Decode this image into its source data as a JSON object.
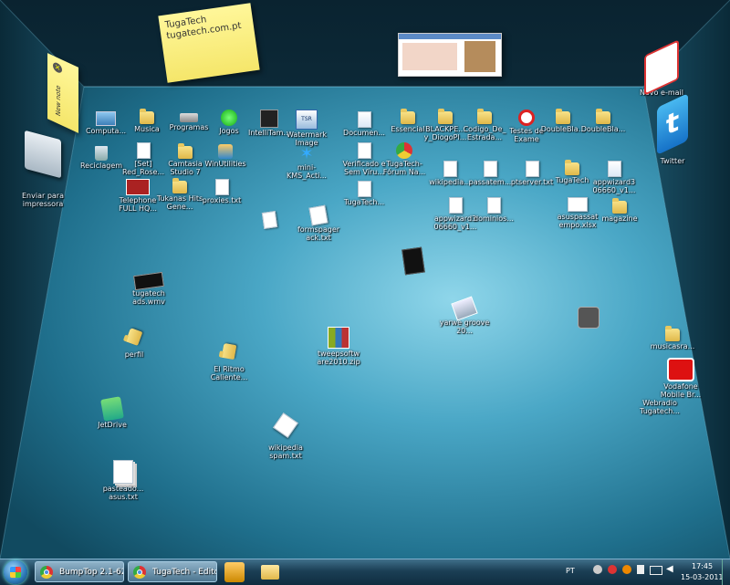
{
  "notes": {
    "note1": "TugaTech\ntugatech.com.pt",
    "note2": "New note"
  },
  "walls": {
    "left": [
      {
        "name": "printer",
        "label": "Enviar para impressora"
      }
    ],
    "right": [
      {
        "name": "new-email",
        "label": "Novo e-mail"
      },
      {
        "name": "twitter",
        "label": "Twitter"
      }
    ]
  },
  "desktop": {
    "row1": [
      "Computa...",
      "Musica",
      "Programas",
      "Jogos",
      "IntelliTam...",
      "Watermark Image",
      "Documen...",
      "Essencial",
      "BLACKPE... y_DiogoPl...",
      "Codigo_De_ Estrada...",
      "Testes de Exame",
      "DoubleBla...",
      "DoubleBla..."
    ],
    "row2": [
      "Reciclagem",
      "[Set] Red_Rose...",
      "Camtasia Studio 7",
      "WinUtilities",
      "mini-KMS_Acti...",
      "Verificado e Sem Víru...",
      "TugaTech-Fórum Na..."
    ],
    "row3": [
      "wikipedia...",
      "passatem...",
      "ptserver.txt",
      "TugaTech",
      "appwizard3 06660_v1..."
    ],
    "misc": {
      "telephone": "Telephone FULL HQ...",
      "tukanas": "Tukanas Hits Gene...",
      "proxies": "proxies.txt",
      "tugatech_doc": "TugaTech...",
      "appwiz2": "appwizard3 06660_v1...",
      "dominios": "dominios...",
      "asuspassat": "asuspassat empo.xlsx",
      "magazine": "magazine",
      "formspager": "formspager ack.txt",
      "tugatech_ads": "tugatech ads.wmv",
      "perfil": "perfil",
      "elritmo": "El Ritmo Caliente...",
      "tweepsoft": "tweepsoftw are2010.zip",
      "yarwe": "yarwe groove 20...",
      "musicasra": "musicasra...",
      "vodafone": "Vodafone Mobile Br...",
      "webradio": "Webradio Tugatech...",
      "jetdrive": "JetDrive",
      "wikispam": "wikipedia spam.txt",
      "paste": "pasteado... asus.txt"
    }
  },
  "taskbar": {
    "btn1": "BumpTop 2.1-622...",
    "btn2": "TugaTech - Editor...",
    "lang": "PT",
    "time": "17:45",
    "date": "15-03-2011"
  }
}
